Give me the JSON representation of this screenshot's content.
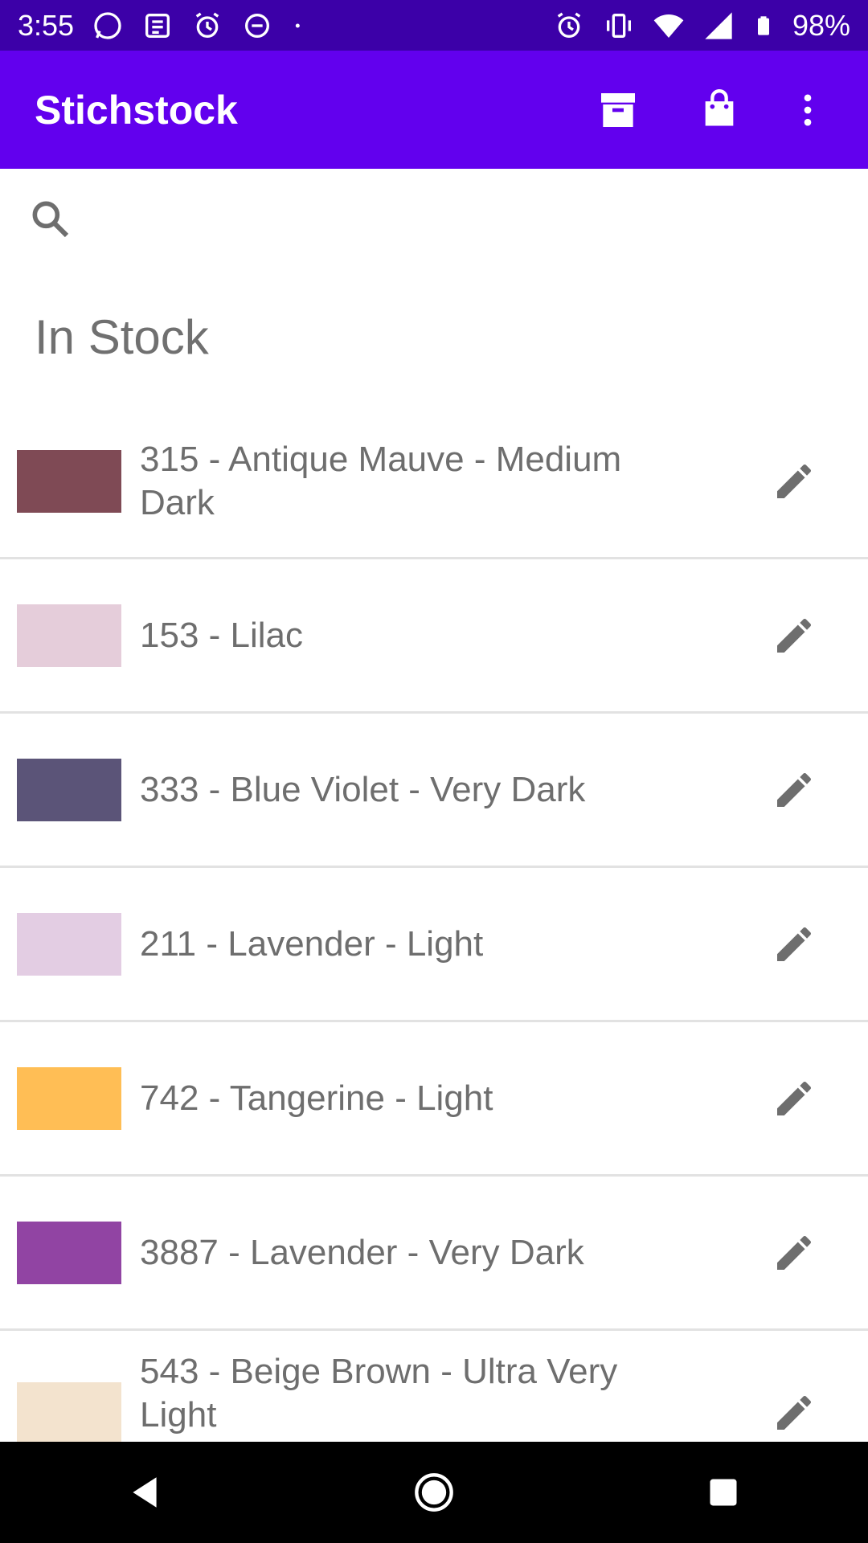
{
  "status_bar": {
    "time": "3:55",
    "battery": "98%",
    "left_icons": [
      "whatsapp-icon",
      "news-icon",
      "alarm-icon",
      "data-saver-icon",
      "dot-icon"
    ],
    "right_icons": [
      "alarm-icon",
      "vibrate-icon",
      "wifi-icon",
      "signal-icon",
      "battery-icon"
    ]
  },
  "app_bar": {
    "title": "Stichstock",
    "actions": [
      "archive-icon",
      "shopping-bag-icon",
      "more-vert-icon"
    ]
  },
  "search": {
    "placeholder": "",
    "value": ""
  },
  "section": {
    "title": "In Stock"
  },
  "items": [
    {
      "label": "315 - Antique Mauve - Medium Dark",
      "color": "#7f4a55"
    },
    {
      "label": "153 - Lilac",
      "color": "#e5cdda"
    },
    {
      "label": "333 - Blue Violet - Very Dark",
      "color": "#5b5478"
    },
    {
      "label": "211 - Lavender - Light",
      "color": "#e3cde3"
    },
    {
      "label": "742 - Tangerine - Light",
      "color": "#ffbe55"
    },
    {
      "label": "3887 - Lavender - Very Dark",
      "color": "#9144a3"
    },
    {
      "label": "543 - Beige Brown - Ultra Very Light",
      "color": "#f3e3ce"
    }
  ],
  "colors": {
    "status_bar": "#3c00a8",
    "app_bar": "#6200ee",
    "text": "#6e6e6e",
    "divider": "#e2e2e2",
    "icon": "#6e6e6e"
  }
}
